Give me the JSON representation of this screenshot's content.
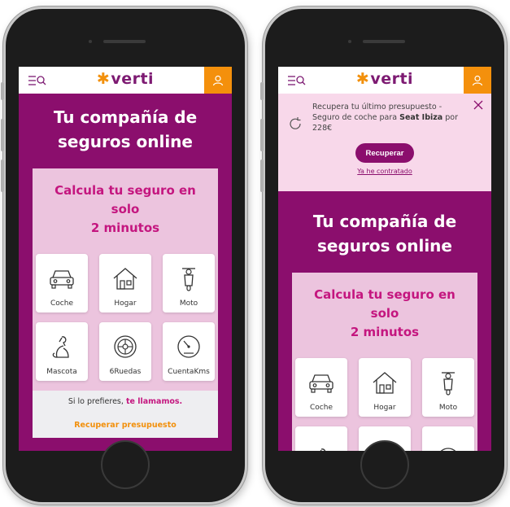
{
  "logo_text": "verti",
  "logo_star": "✱",
  "left": {
    "hero_title_line1": "Tu compañía de",
    "hero_title_line2": "seguros online",
    "calc_title_line1": "Calcula tu seguro en solo",
    "calc_title_line2": "2 minutos",
    "tiles": [
      {
        "label": "Coche",
        "icon": "car-icon"
      },
      {
        "label": "Hogar",
        "icon": "house-icon"
      },
      {
        "label": "Moto",
        "icon": "scooter-icon"
      },
      {
        "label": "Mascota",
        "icon": "dog-icon"
      },
      {
        "label": "6Ruedas",
        "icon": "wheel-icon"
      },
      {
        "label": "CuentaKms",
        "icon": "speedometer-icon"
      }
    ],
    "callback_text": "Si lo prefieres,",
    "callback_link": "te llamamos.",
    "recover_link": "Recuperar presupuesto"
  },
  "right": {
    "banner_line1": "Recupera tu último presupuesto - Seguro",
    "banner_line2_prefix": "de coche para",
    "banner_car": "Seat Ibiza",
    "banner_line2_suffix": "por 228€",
    "recover_button": "Recuperar",
    "contracted_link": "Ya he contratado",
    "hero_title_line1": "Tu compañía de",
    "hero_title_line2": "seguros online",
    "calc_title_line1": "Calcula tu seguro en solo",
    "calc_title_line2": "2 minutos",
    "tiles": [
      {
        "label": "Coche",
        "icon": "car-icon"
      },
      {
        "label": "Hogar",
        "icon": "house-icon"
      },
      {
        "label": "Moto",
        "icon": "scooter-icon"
      },
      {
        "label": "",
        "icon": "dog-icon"
      },
      {
        "label": "",
        "icon": "wheel-icon"
      },
      {
        "label": "",
        "icon": "speedometer-icon"
      }
    ]
  },
  "colors": {
    "brand_purple": "#8b0e6d",
    "brand_orange": "#f4900c",
    "accent_pink": "#c4167f",
    "card_pink": "#ecc4de",
    "banner_pink": "#f8d8ea"
  }
}
